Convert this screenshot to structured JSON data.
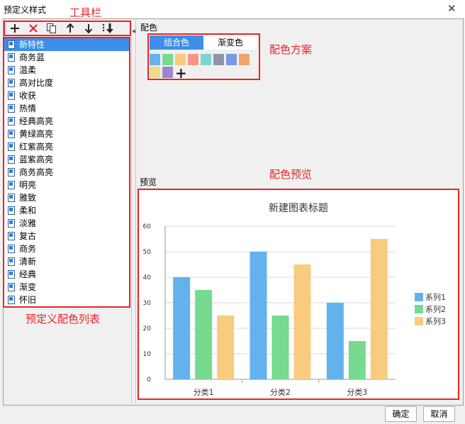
{
  "window": {
    "title": "预定义样式",
    "close_label": "✕"
  },
  "toolbar": {
    "annotation": "工具栏",
    "buttons": [
      {
        "name": "add-icon"
      },
      {
        "name": "delete-icon"
      },
      {
        "name": "copy-icon"
      },
      {
        "name": "move-up-icon"
      },
      {
        "name": "move-down-icon"
      },
      {
        "name": "move-to-bottom-icon"
      }
    ]
  },
  "list": {
    "annotation": "预定义配色列表",
    "selected_index": 0,
    "items": [
      "新特性",
      "商务蓝",
      "温柔",
      "高对比度",
      "收获",
      "热情",
      "经典高亮",
      "黄绿高亮",
      "红紫高亮",
      "蓝紫高亮",
      "商务高亮",
      "明亮",
      "雅致",
      "柔和",
      "淡雅",
      "复古",
      "商务",
      "清新",
      "经典",
      "渐变",
      "怀旧"
    ]
  },
  "color": {
    "section_label": "配色",
    "annotation": "配色方案",
    "tabs": [
      "组合色",
      "渐变色"
    ],
    "active_tab": 0,
    "swatches": [
      "#63b2ee",
      "#76da91",
      "#f8cb7f",
      "#f89588",
      "#7cd6cf",
      "#9192ab",
      "#7898e1",
      "#efa666",
      "#eddd86",
      "#9987ce"
    ],
    "add_symbol": "+"
  },
  "preview": {
    "section_label": "预览",
    "annotation": "配色预览"
  },
  "chart_data": {
    "type": "bar",
    "title": "新建图表标题",
    "categories": [
      "分类1",
      "分类2",
      "分类3"
    ],
    "ylim": [
      0,
      60
    ],
    "yticks": [
      "0",
      "10",
      "20",
      "30",
      "40",
      "50",
      "60"
    ],
    "grid": true,
    "legend_position": "right",
    "series": [
      {
        "name": "系列1",
        "color": "#63b2ee",
        "values": [
          40,
          50,
          30
        ]
      },
      {
        "name": "系列2",
        "color": "#76da91",
        "values": [
          35,
          25,
          15
        ]
      },
      {
        "name": "系列3",
        "color": "#f8cb7f",
        "values": [
          25,
          45,
          55
        ]
      }
    ]
  },
  "footer": {
    "ok_label": "确定",
    "cancel_label": "取消"
  }
}
